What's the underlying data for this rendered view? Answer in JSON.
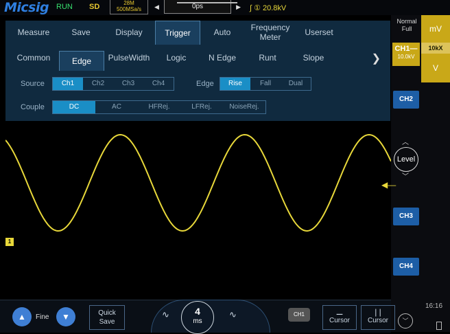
{
  "status": {
    "logo": "Micsig",
    "run_state": "RUN",
    "storage": "SD",
    "record_length": "28M",
    "sample_rate": "500MSa/s",
    "timebase_offset": "0ps",
    "trigger_level_text": "① 20.8kV",
    "acq_mode_line1": "Normal",
    "acq_mode_line2": "Full",
    "clock": "16:16"
  },
  "right_panel": {
    "unit_mv": "mV",
    "unit_v": "V",
    "ch1_label": "CH1",
    "ch1_scale": "10.0kV",
    "probe_ratio": "10kX",
    "ch2": "CH2",
    "ch3": "CH3",
    "ch4": "CH4",
    "level_label": "Level"
  },
  "menu": {
    "tabs": [
      "Measure",
      "Save",
      "Display",
      "Trigger",
      "Auto",
      "Frequency Meter",
      "Userset"
    ],
    "selected_tab": "Trigger",
    "trigger_types": [
      "Common",
      "Edge",
      "PulseWidth",
      "Logic",
      "N Edge",
      "Runt",
      "Slope"
    ],
    "selected_trigger_type": "Edge",
    "source_label": "Source",
    "source_options": [
      "Ch1",
      "Ch2",
      "Ch3",
      "Ch4"
    ],
    "source_selected": "Ch1",
    "edge_label": "Edge",
    "edge_options": [
      "Rise",
      "Fall",
      "Dual"
    ],
    "edge_selected": "Rise",
    "couple_label": "Couple",
    "couple_options": [
      "DC",
      "AC",
      "HFRej.",
      "LFRej.",
      "NoiseRej."
    ],
    "couple_selected": "DC"
  },
  "waveform": {
    "channel_marker": "1",
    "color": "#e8d83a",
    "signal": "sine",
    "cycles_visible": 3.1
  },
  "bottom_bar": {
    "fine_label": "Fine",
    "quick_save_line1": "Quick",
    "quick_save_line2": "Save",
    "timebase_value": "4",
    "timebase_unit": "ms",
    "ch1_toggle_label": "CH1",
    "cursor_h_label": "Cursor",
    "cursor_v_label": "Cursor"
  },
  "colors": {
    "accent_blue": "#1a8ec6",
    "ch1_yellow": "#c9a818",
    "menu_bg": "#102a3f",
    "button_blue": "#3f7fd4"
  }
}
